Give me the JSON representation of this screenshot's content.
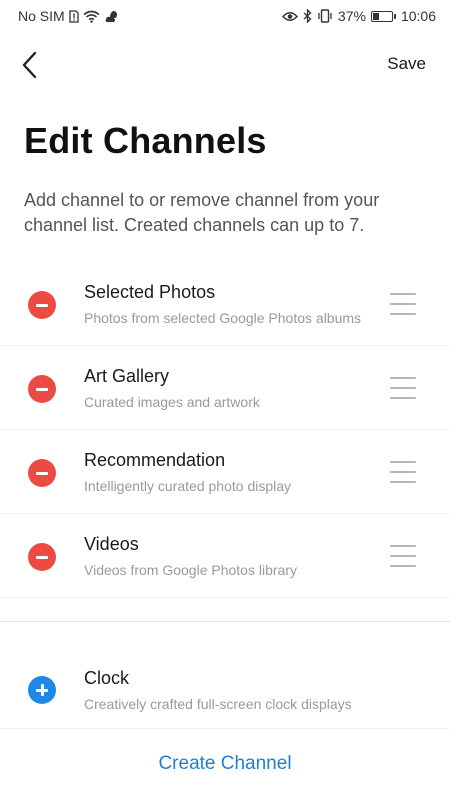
{
  "status_bar": {
    "carrier": "No SIM",
    "battery": "37%",
    "battery_level": 0.37,
    "time": "10:06"
  },
  "header": {
    "back_icon": "chevron-left-icon",
    "save_label": "Save",
    "title": "Edit Channels",
    "description": "Add channel to or remove channel from your channel list. Created channels can up to 7."
  },
  "channels": [
    {
      "name": "Selected Photos",
      "description": "Photos from selected Google Photos albums"
    },
    {
      "name": "Art Gallery",
      "description": "Curated images and artwork"
    },
    {
      "name": "Recommendation",
      "description": "Intelligently curated photo display"
    },
    {
      "name": "Videos",
      "description": "Videos from Google Photos library"
    }
  ],
  "available_channels": [
    {
      "name": "Clock",
      "description": "Creatively crafted full-screen clock displays"
    }
  ],
  "footer": {
    "create_label": "Create Channel"
  },
  "colors": {
    "remove": "#ec4b44",
    "add": "#1e88e5",
    "link": "#1f7fd1"
  }
}
